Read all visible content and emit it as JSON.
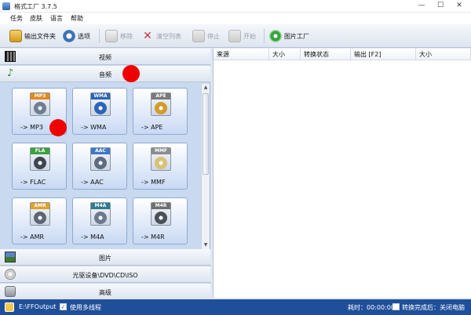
{
  "window": {
    "title": "格式工厂 3.7.5",
    "min_glyph": "—",
    "max_glyph": "☐",
    "close_glyph": "✕"
  },
  "menu": [
    "任务",
    "皮肤",
    "语言",
    "帮助"
  ],
  "toolbar": {
    "output_folder": "输出文件夹",
    "options": "选项",
    "remove": "移除",
    "clear_list": "清空列表",
    "stop": "停止",
    "start": "开始",
    "picture_factory": "图片工厂"
  },
  "categories": {
    "video": "视频",
    "audio": "音频",
    "picture": "图片",
    "optical": "光驱设备\\DVD\\CD\\ISO",
    "advanced": "高级"
  },
  "audio_formats": [
    {
      "badge": "MP3",
      "label": "-> MP3",
      "color": "#e38a1f",
      "glyph_color": "#6e7e93"
    },
    {
      "badge": "WMA",
      "label": "-> WMA",
      "color": "#2c64b8",
      "glyph_color": "#2c64b8"
    },
    {
      "badge": "APE",
      "label": "-> APE",
      "color": "#7a7a7a",
      "glyph_color": "#d39b2a"
    },
    {
      "badge": "FLA",
      "label": "-> FLAC",
      "color": "#3aa13f",
      "glyph_color": "#3f4652"
    },
    {
      "badge": "AAC",
      "label": "-> AAC",
      "color": "#3d79c9",
      "glyph_color": "#5d6c82"
    },
    {
      "badge": "MMF",
      "label": "-> MMF",
      "color": "#8c8c8c",
      "glyph_color": "#d8c27a"
    },
    {
      "badge": "AMR",
      "label": "-> AMR",
      "color": "#e0a22a",
      "glyph_color": "#5e6573"
    },
    {
      "badge": "M4A",
      "label": "-> M4A",
      "color": "#2f7b8e",
      "glyph_color": "#6b7a8f"
    },
    {
      "badge": "M4R",
      "label": "-> M4R",
      "color": "#6f6f6f",
      "glyph_color": "#4a4f58"
    }
  ],
  "task_columns": [
    "来源",
    "大小",
    "转换状态",
    "输出 [F2]",
    "大小"
  ],
  "status": {
    "output_path": "E:\\FFOutput",
    "multithread_label": "使用多线程",
    "multithread_checked": "✓",
    "elapsed_label": "耗时：00:00:00",
    "shutdown_label": "转换完成后：关闭电脑"
  }
}
